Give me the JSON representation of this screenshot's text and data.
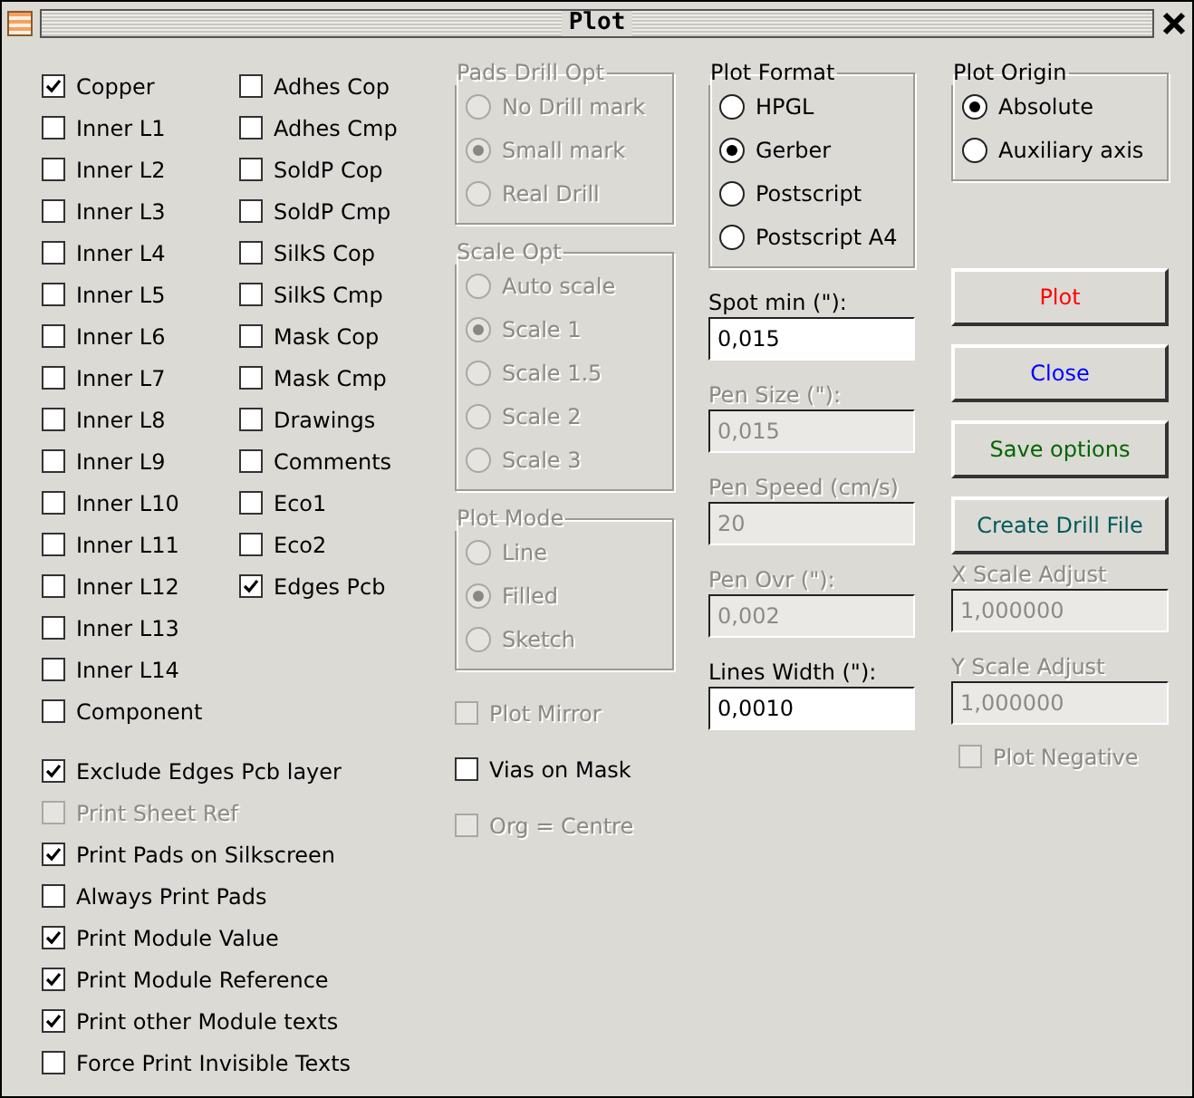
{
  "window": {
    "title": "Plot"
  },
  "layers": {
    "column_1": [
      {
        "label": "Copper",
        "checked": true
      },
      {
        "label": "Inner L1",
        "checked": false
      },
      {
        "label": "Inner L2",
        "checked": false
      },
      {
        "label": "Inner L3",
        "checked": false
      },
      {
        "label": "Inner L4",
        "checked": false
      },
      {
        "label": "Inner L5",
        "checked": false
      },
      {
        "label": "Inner L6",
        "checked": false
      },
      {
        "label": "Inner L7",
        "checked": false
      },
      {
        "label": "Inner L8",
        "checked": false
      },
      {
        "label": "Inner L9",
        "checked": false
      },
      {
        "label": "Inner L10",
        "checked": false
      },
      {
        "label": "Inner L11",
        "checked": false
      },
      {
        "label": "Inner L12",
        "checked": false
      },
      {
        "label": "Inner L13",
        "checked": false
      },
      {
        "label": "Inner L14",
        "checked": false
      },
      {
        "label": "Component",
        "checked": false
      }
    ],
    "column_2": [
      {
        "label": "Adhes Cop",
        "checked": false
      },
      {
        "label": "Adhes Cmp",
        "checked": false
      },
      {
        "label": "SoldP Cop",
        "checked": false
      },
      {
        "label": "SoldP Cmp",
        "checked": false
      },
      {
        "label": "SilkS Cop",
        "checked": false
      },
      {
        "label": "SilkS Cmp",
        "checked": false
      },
      {
        "label": "Mask Cop",
        "checked": false
      },
      {
        "label": "Mask Cmp",
        "checked": false
      },
      {
        "label": "Drawings",
        "checked": false
      },
      {
        "label": "Comments",
        "checked": false
      },
      {
        "label": "Eco1",
        "checked": false
      },
      {
        "label": "Eco2",
        "checked": false
      },
      {
        "label": "Edges Pcb",
        "checked": true
      }
    ]
  },
  "options": [
    {
      "label": "Exclude Edges Pcb layer",
      "checked": true,
      "disabled": false
    },
    {
      "label": "Print Sheet Ref",
      "checked": false,
      "disabled": true
    },
    {
      "label": "Print Pads on Silkscreen",
      "checked": true,
      "disabled": false
    },
    {
      "label": "Always Print Pads",
      "checked": false,
      "disabled": false
    },
    {
      "label": "Print Module Value",
      "checked": true,
      "disabled": false
    },
    {
      "label": "Print Module Reference",
      "checked": true,
      "disabled": false
    },
    {
      "label": "Print other Module texts",
      "checked": true,
      "disabled": false
    },
    {
      "label": "Force Print Invisible Texts",
      "checked": false,
      "disabled": false
    }
  ],
  "pads_drill_opt": {
    "title": "Pads Drill Opt",
    "disabled": true,
    "options": [
      {
        "label": "No Drill mark",
        "selected": false
      },
      {
        "label": "Small mark",
        "selected": true
      },
      {
        "label": "Real Drill",
        "selected": false
      }
    ]
  },
  "scale_opt": {
    "title": "Scale Opt",
    "disabled": true,
    "options": [
      {
        "label": "Auto scale",
        "selected": false
      },
      {
        "label": "Scale 1",
        "selected": true
      },
      {
        "label": "Scale 1.5",
        "selected": false
      },
      {
        "label": "Scale 2",
        "selected": false
      },
      {
        "label": "Scale 3",
        "selected": false
      }
    ]
  },
  "plot_mode": {
    "title": "Plot Mode",
    "disabled": true,
    "options": [
      {
        "label": "Line",
        "selected": false
      },
      {
        "label": "Filled",
        "selected": true
      },
      {
        "label": "Sketch",
        "selected": false
      }
    ]
  },
  "middle_options": [
    {
      "label": "Plot Mirror",
      "checked": false,
      "disabled": true
    },
    {
      "label": "Vias on Mask",
      "checked": false,
      "disabled": false
    },
    {
      "label": "Org = Centre",
      "checked": false,
      "disabled": true
    }
  ],
  "plot_format": {
    "title": "Plot Format",
    "disabled": false,
    "options": [
      {
        "label": "HPGL",
        "selected": false
      },
      {
        "label": "Gerber",
        "selected": true
      },
      {
        "label": "Postscript",
        "selected": false
      },
      {
        "label": "Postscript A4",
        "selected": false
      }
    ]
  },
  "fields": [
    {
      "label": "Spot min (\"):",
      "value": "0,015",
      "disabled": false
    },
    {
      "label": "Pen Size (\"):",
      "value": "0,015",
      "disabled": true
    },
    {
      "label": "Pen Speed (cm/s)",
      "value": "20",
      "disabled": true
    },
    {
      "label": "Pen Ovr (\"):",
      "value": "0,002",
      "disabled": true
    },
    {
      "label": "Lines Width (\"):",
      "value": "0,0010",
      "disabled": false
    }
  ],
  "plot_origin": {
    "title": "Plot Origin",
    "disabled": false,
    "options": [
      {
        "label": "Absolute",
        "selected": true
      },
      {
        "label": "Auxiliary axis",
        "selected": false
      }
    ]
  },
  "buttons": [
    {
      "label": "Plot",
      "color": "#ff0000"
    },
    {
      "label": "Close",
      "color": "#0000ff"
    },
    {
      "label": "Save options",
      "color": "#006400"
    },
    {
      "label": "Create Drill File",
      "color": "#005a5a"
    }
  ],
  "scale_fields": [
    {
      "label": "X Scale Adjust",
      "value": "1,000000",
      "disabled": true
    },
    {
      "label": "Y Scale Adjust",
      "value": "1,000000",
      "disabled": true
    }
  ],
  "plot_negative": {
    "label": "Plot Negative",
    "checked": false,
    "disabled": true
  }
}
